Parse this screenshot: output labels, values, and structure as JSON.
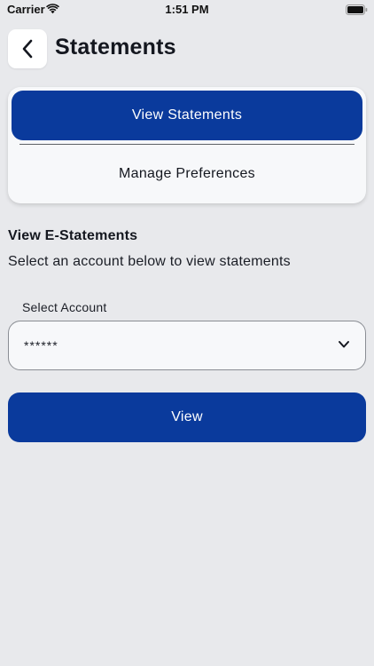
{
  "status_bar": {
    "carrier": "Carrier",
    "time": "1:51 PM",
    "wifi_icon": "wifi-icon",
    "battery_icon": "battery-icon"
  },
  "header": {
    "back_icon": "chevron-left-icon",
    "title": "Statements"
  },
  "segments": {
    "active_label": "View Statements",
    "inactive_label": "Manage Preferences",
    "selected": "View Statements"
  },
  "section": {
    "heading": "View E-Statements",
    "description": "Select an account below to view statements"
  },
  "account_select": {
    "label": "Select Account",
    "value": "******",
    "icon": "chevron-down-icon"
  },
  "view_button": {
    "label": "View"
  },
  "colors": {
    "background": "#e8e9ec",
    "primary": "#0a3a9c",
    "card": "#f7f8fa",
    "text": "#14171f"
  }
}
